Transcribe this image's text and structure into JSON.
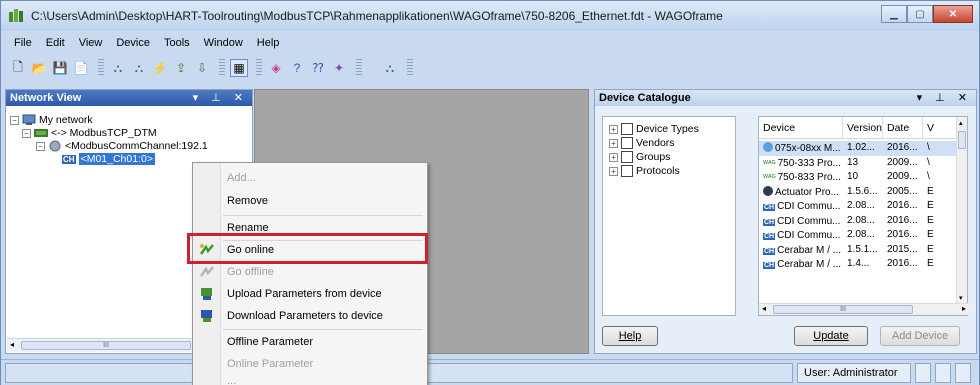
{
  "window": {
    "title": "C:\\Users\\Admin\\Desktop\\HART-Toolrouting\\ModbusTCP\\Rahmenapplikationen\\WAGOframe\\750-8206_Ethernet.fdt - WAGOframe"
  },
  "menu": {
    "file": "File",
    "edit": "Edit",
    "view": "View",
    "device": "Device",
    "tools": "Tools",
    "window": "Window",
    "help": "Help"
  },
  "network_view": {
    "title": "Network View",
    "controls": "▾ ⊥ ✕",
    "tree": {
      "root": "My network",
      "dtm": "<-> ModbusTCP_DTM",
      "channel": "<ModbusCommChannel:192.1",
      "device": "<M01_Ch01:0>"
    },
    "hscroll_label": "III"
  },
  "context_menu": {
    "add": "Add...",
    "remove": "Remove",
    "rename": "Rename",
    "go_online": "Go online",
    "go_offline": "Go offline",
    "upload": "Upload Parameters from device",
    "download": "Download Parameters to device",
    "offline_param": "Offline Parameter",
    "online_param": "Online Parameter",
    "more": "..."
  },
  "device_catalogue": {
    "title": "Device Catalogue",
    "controls": "▾ ⊥ ✕",
    "categories": [
      "Device Types",
      "Vendors",
      "Groups",
      "Protocols"
    ],
    "columns": [
      "Device",
      "Version",
      "Date",
      "V"
    ],
    "rows": [
      [
        "075x-08xx M...",
        "1.02...",
        "2016...",
        "\\"
      ],
      [
        "750-333 Pro...",
        "13",
        "2009...",
        "\\"
      ],
      [
        "750-833 Pro...",
        "10",
        "2009...",
        "\\"
      ],
      [
        "Actuator Pro...",
        "1.5.6...",
        "2005...",
        "E"
      ],
      [
        "CDI Commu...",
        "2.08...",
        "2016...",
        "E"
      ],
      [
        "CDI Commu...",
        "2.08...",
        "2016...",
        "E"
      ],
      [
        "CDI Commu...",
        "2.08...",
        "2016...",
        "E"
      ],
      [
        "Cerabar M / ...",
        "1.5.1...",
        "2015...",
        "E"
      ],
      [
        "Cerabar M / ...",
        "1.4...",
        "2016...",
        "E"
      ]
    ],
    "row_icons": [
      "dtm-icon",
      "vendor-icon",
      "vendor-icon",
      "gear-icon",
      "hart-icon",
      "hart-icon",
      "hart-icon",
      "hart-icon",
      "hart-icon"
    ],
    "hscroll_label": "III",
    "help_button": "Help",
    "update_button": "Update",
    "add_device_button": "Add Device"
  },
  "status": {
    "user": "User: Administrator"
  },
  "colors": {
    "highlight_box": "#d31f2b",
    "panel_title": "#2d5aa8",
    "workspace": "#a5a5a5"
  }
}
